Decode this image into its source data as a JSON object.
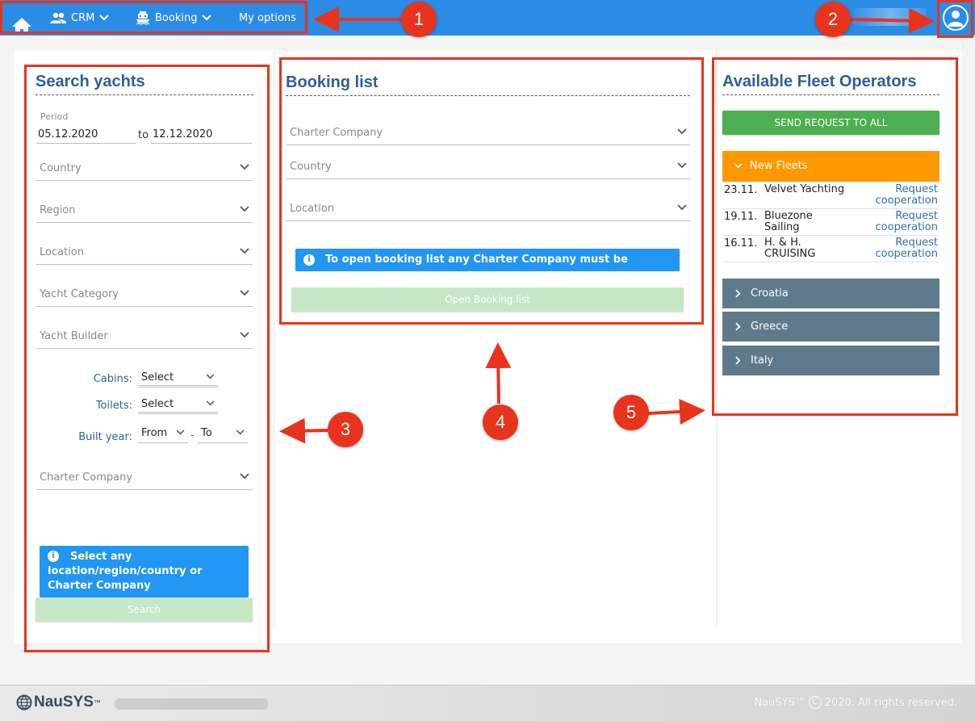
{
  "nav": {
    "crm_label": "CRM",
    "booking_label": "Booking",
    "options_label": "My options"
  },
  "search": {
    "title": "Search yachts",
    "period_label": "Period",
    "date_from": "05.12.2020",
    "to_label": "to",
    "date_to": "12.12.2020",
    "country_placeholder": "Country",
    "region_placeholder": "Region",
    "location_placeholder": "Location",
    "category_placeholder": "Yacht Category",
    "builder_placeholder": "Yacht Builder",
    "cabins_label": "Cabins:",
    "cabins_value": "Select",
    "toilets_label": "Toilets:",
    "toilets_value": "Select",
    "built_year_label": "Built year:",
    "year_from": "From",
    "year_sep": "-",
    "year_to": "To",
    "charter_placeholder": "Charter Company",
    "info_text": "Select any location/region/country or Charter Company",
    "search_button": "Search"
  },
  "booking": {
    "title": "Booking list",
    "charter_placeholder": "Charter Company",
    "country_placeholder": "Country",
    "location_placeholder": "Location",
    "info_text": "To open booking list any Charter Company must be selected",
    "open_button": "Open Booking list"
  },
  "fleet": {
    "title": "Available Fleet Operators",
    "send_all_button": "SEND REQUEST TO ALL",
    "new_fleets_label": "New Fleets",
    "new_fleets": [
      {
        "date": "23.11.",
        "name": "Velvet Yachting",
        "action": "Request cooperation"
      },
      {
        "date": "19.11.",
        "name": "Bluezone Sailing",
        "action": "Request cooperation"
      },
      {
        "date": "16.11.",
        "name": "H. & H. CRUISING",
        "action": "Request cooperation"
      }
    ],
    "regions": [
      "Croatia",
      "Greece",
      "Italy"
    ]
  },
  "annotations": [
    "1",
    "2",
    "3",
    "4",
    "5"
  ],
  "footer": {
    "logo_text": "NauSYS",
    "logo_tm": "™",
    "copyright_brand": "NauSYS™",
    "copyright_symbol": "C",
    "copyright_text": "2020. All rights reserved."
  },
  "colors": {
    "topbar": "#2b8ce6",
    "title": "#2f5f95",
    "green": "#4caf50",
    "orange": "#ff9800",
    "slate": "#5f7a8a",
    "info": "#2196f3",
    "annotation": "#e8341c"
  }
}
